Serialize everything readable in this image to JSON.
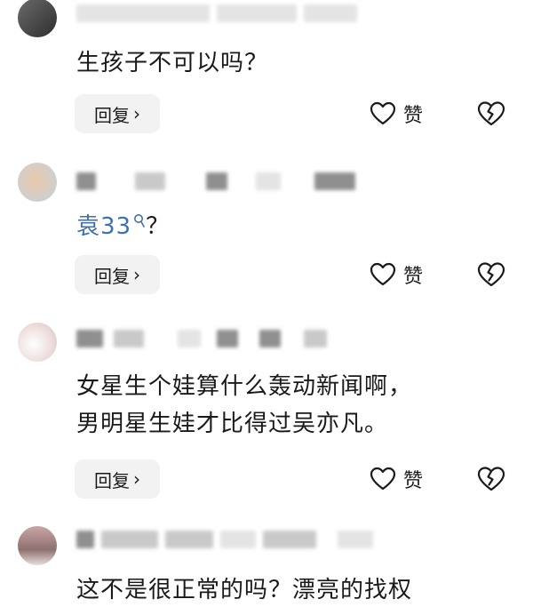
{
  "comments": [
    {
      "text_lines": [
        "生孩子不可以吗？"
      ],
      "reply_label": "回复",
      "like_label": "赞",
      "like_icon": "heart-outline-icon",
      "dislike_icon": "broken-heart-icon"
    },
    {
      "mention": "袁33",
      "mention_icon": "search-icon",
      "text_after": "？",
      "reply_label": "回复",
      "like_label": "赞",
      "like_icon": "heart-outline-icon",
      "dislike_icon": "broken-heart-icon"
    },
    {
      "text_lines": [
        "女星生个娃算什么轰动新闻啊，",
        "男明星生娃才比得过吴亦凡。"
      ],
      "reply_label": "回复",
      "like_label": "赞",
      "like_icon": "heart-outline-icon",
      "dislike_icon": "broken-heart-icon"
    },
    {
      "text_lines": [
        "这不是很正常的吗？漂亮的找权"
      ]
    }
  ],
  "reply_chevron": "›",
  "colors": {
    "mention": "#3e6fb3",
    "reply_bg": "#f2f2f2",
    "text": "#1a1a1a"
  }
}
